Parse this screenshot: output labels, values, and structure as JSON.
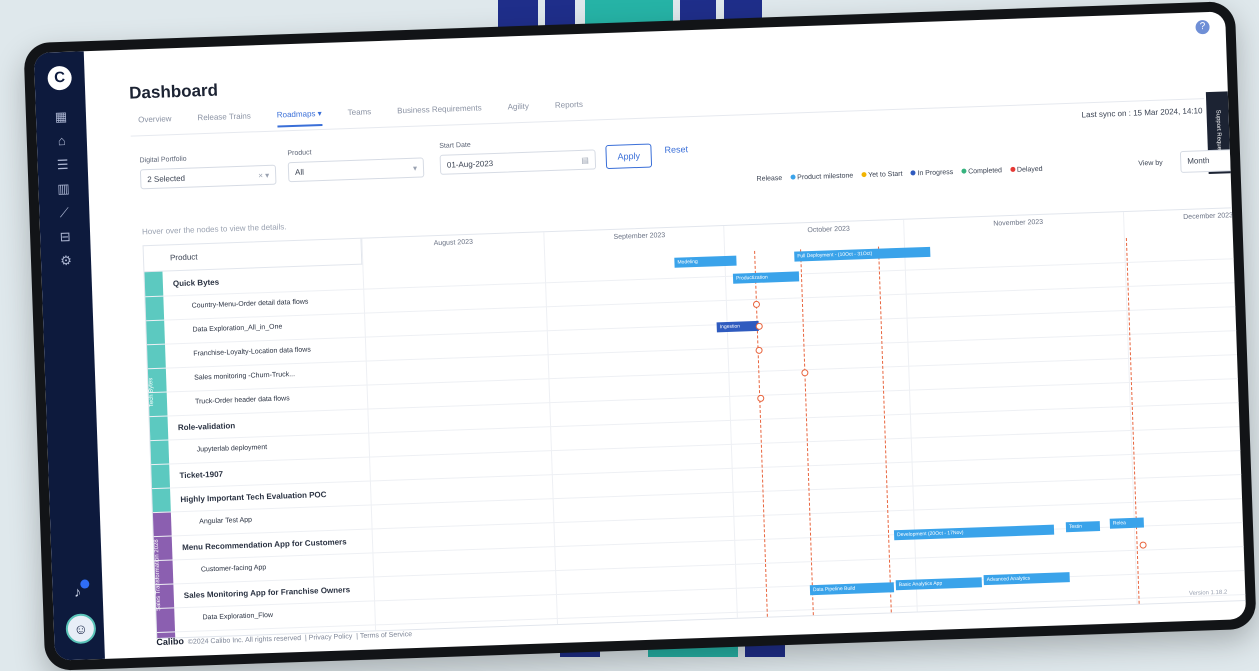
{
  "app": {
    "title": "Dashboard",
    "help_icon": "question-icon"
  },
  "tabs": [
    {
      "label": "Overview"
    },
    {
      "label": "Release Trains"
    },
    {
      "label": "Roadmaps",
      "active": true
    },
    {
      "label": "Teams"
    },
    {
      "label": "Business Requirements"
    },
    {
      "label": "Agility"
    },
    {
      "label": "Reports"
    }
  ],
  "filters": {
    "portfolio": {
      "label": "Digital Portfolio",
      "value": "2 Selected"
    },
    "product": {
      "label": "Product",
      "value": "All"
    },
    "start_date": {
      "label": "Start Date",
      "value": "01-Aug-2023"
    },
    "apply_label": "Apply",
    "reset_label": "Reset"
  },
  "sync": "Last sync on : 15 Mar 2024, 14:10",
  "support_label": "Support Request",
  "legend": {
    "release": "Release",
    "items": [
      {
        "label": "Product milestone",
        "color": "#3aa3ea"
      },
      {
        "label": "Yet to Start",
        "color": "#f2b400"
      },
      {
        "label": "In Progress",
        "color": "#2f5bbf"
      },
      {
        "label": "Completed",
        "color": "#36b37e"
      },
      {
        "label": "Delayed",
        "color": "#e53935"
      }
    ]
  },
  "view_by": {
    "label": "View by",
    "value": "Month"
  },
  "hint": "Hover over the nodes to view the details.",
  "gantt": {
    "product_header": "Product",
    "months": [
      "August 2023",
      "September 2023",
      "October 2023",
      "November 2023",
      "December 2023"
    ],
    "groups": [
      {
        "label": "Tech Bytes",
        "color": "#5cc9c0"
      },
      {
        "label": "Sales Transformation 2028",
        "color": "#8b5fb0"
      }
    ],
    "rows": [
      {
        "label": "Quick Bytes",
        "bold": true
      },
      {
        "label": "Country-Menu-Order detail data flows"
      },
      {
        "label": "Data Exploration_All_in_One"
      },
      {
        "label": "Franchise-Loyalty-Location data flows"
      },
      {
        "label": "Sales monitoring -Churn-Truck..."
      },
      {
        "label": "Truck-Order header data flows"
      },
      {
        "label": "Role-validation",
        "bold": true
      },
      {
        "label": "Jupyterlab deployment"
      },
      {
        "label": "Ticket-1907",
        "bold": true
      },
      {
        "label": "Highly Important Tech Evaluation POC",
        "bold": true
      },
      {
        "label": "Angular Test App"
      },
      {
        "label": "Menu Recommendation App for Customers",
        "bold": true
      },
      {
        "label": "Customer-facing App"
      },
      {
        "label": "Sales Monitoring App for Franchise Owners",
        "bold": true
      },
      {
        "label": "Data Exploration_Flow"
      }
    ],
    "bars": [
      {
        "label": "Modeling"
      },
      {
        "label": "Full Deployment - (10Oct - 31Oct)"
      },
      {
        "label": "Productization"
      },
      {
        "label": "Ingestion"
      },
      {
        "label": "Development (20Oct - 17Nov)"
      },
      {
        "label": "Testin"
      },
      {
        "label": "Relea"
      },
      {
        "label": "Data Pipeline Build"
      },
      {
        "label": "Basic Analytics App"
      },
      {
        "label": "Advanced Analytics"
      }
    ]
  },
  "footer": {
    "brand": "Calibo",
    "copyright": "©2024 Calibo Inc. All rights reserved",
    "privacy": "Privacy Policy",
    "terms": "Terms of Service"
  },
  "version": "Version 1.18.2"
}
